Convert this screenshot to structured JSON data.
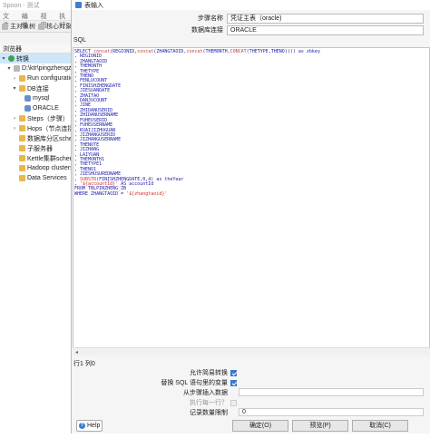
{
  "background_window": {
    "title": "Spoon - 测试",
    "menu": [
      "文件",
      "编辑",
      "视图",
      "执行"
    ],
    "tabs": [
      "主对象树",
      "核心对象"
    ],
    "tree_header": "浏览器",
    "tree": [
      {
        "label": "转换",
        "level": 0,
        "toggle": "▾",
        "icon": "green",
        "selected": true
      },
      {
        "label": "D:\\ktr\\pingzhengzh",
        "level": 1,
        "toggle": "▾",
        "icon": "gray"
      },
      {
        "label": "Run configuratio",
        "level": 2,
        "toggle": "›",
        "icon": "folder"
      },
      {
        "label": "DB连接",
        "level": 2,
        "toggle": "▾",
        "icon": "folder"
      },
      {
        "label": "mysql",
        "level": 3,
        "toggle": "",
        "icon": "db"
      },
      {
        "label": "ORACLE",
        "level": 3,
        "toggle": "",
        "icon": "db"
      },
      {
        "label": "Steps（步骤）",
        "level": 2,
        "toggle": "›",
        "icon": "folder"
      },
      {
        "label": "Hops（节点连接）",
        "level": 2,
        "toggle": "›",
        "icon": "folder"
      },
      {
        "label": "数据库分区schem",
        "level": 2,
        "toggle": "",
        "icon": "folder"
      },
      {
        "label": "子服务器",
        "level": 2,
        "toggle": "",
        "icon": "folder"
      },
      {
        "label": "Kettle集群schem",
        "level": 2,
        "toggle": "",
        "icon": "folder"
      },
      {
        "label": "Hadoop clusters",
        "level": 2,
        "toggle": "",
        "icon": "folder"
      },
      {
        "label": "Data Services",
        "level": 2,
        "toggle": "",
        "icon": "folder"
      }
    ]
  },
  "dialog": {
    "title": "表输入",
    "step_name_label": "步骤名称",
    "step_name_value": "凭证主表（oracle)",
    "connection_label": "数据库连接",
    "connection_value": "ORACLE",
    "sql_label": "SQL",
    "sql_lines": [
      "SELECT concat(REGIONID,concat(ZHANGTAOID,concat(THEMONTH,CONCAT(THETYPE,THENO)))) as zbkey",
      ", REGIONID",
      ", ZHANGTAOID",
      ", THEMONTH",
      ", THETYPE",
      ", THENO",
      ", FENLUCOUNT",
      ", FINISHZHENGDATE",
      ", JIESUANDATE",
      ", ZHAITAO",
      ", DANJUCOUNT",
      ", JINE",
      ", ZHIDANUSERID",
      ", ZHIDANUSERNAME",
      ", FUHEUSERID",
      ", FUHEUSERNAME",
      ", KUAIJIZHUGUAN",
      ", JIZHANGUSERID",
      ", JIZHANGUSERNAME",
      ", THENOTE",
      ", JIZHANG",
      ", LAIYUAN",
      ", THEMONTH1",
      ", THETYPE1",
      ", THENO1",
      ", JIESHUSUREDNAME",
      ", SUBSTR(FINISHZHENGDATE,0,4) as theYear",
      ", '${accountId}' AS accountId",
      "FROM TBLPINZHENG_ZB",
      "WHERE ZHANGTAOID = '${zhangtaoid}'"
    ],
    "cursor_position": "行1 列0",
    "opt_replace_vars_label": "允许简易转换",
    "opt_replace_vars_checked": true,
    "opt_sql_vars_label": "替换 SQL 语句里的变量",
    "opt_sql_vars_checked": true,
    "opt_insert_from_label": "从步骤插入数据",
    "opt_insert_from_value": "",
    "opt_each_row_label": "执行每一行？",
    "opt_each_row_checked": false,
    "opt_limit_label": "记录数量限制",
    "opt_limit_value": "0",
    "help_label": "Help",
    "ok_label": "确定(O)",
    "preview_label": "预览(P)",
    "cancel_label": "取消(C)"
  },
  "colors": {
    "sql_keyword": "#1a1aa8",
    "sql_function": "#c23a3a",
    "sql_string": "#d12c2c",
    "checkbox": "#3a7ac6",
    "selected_node": "#cde6fa"
  }
}
